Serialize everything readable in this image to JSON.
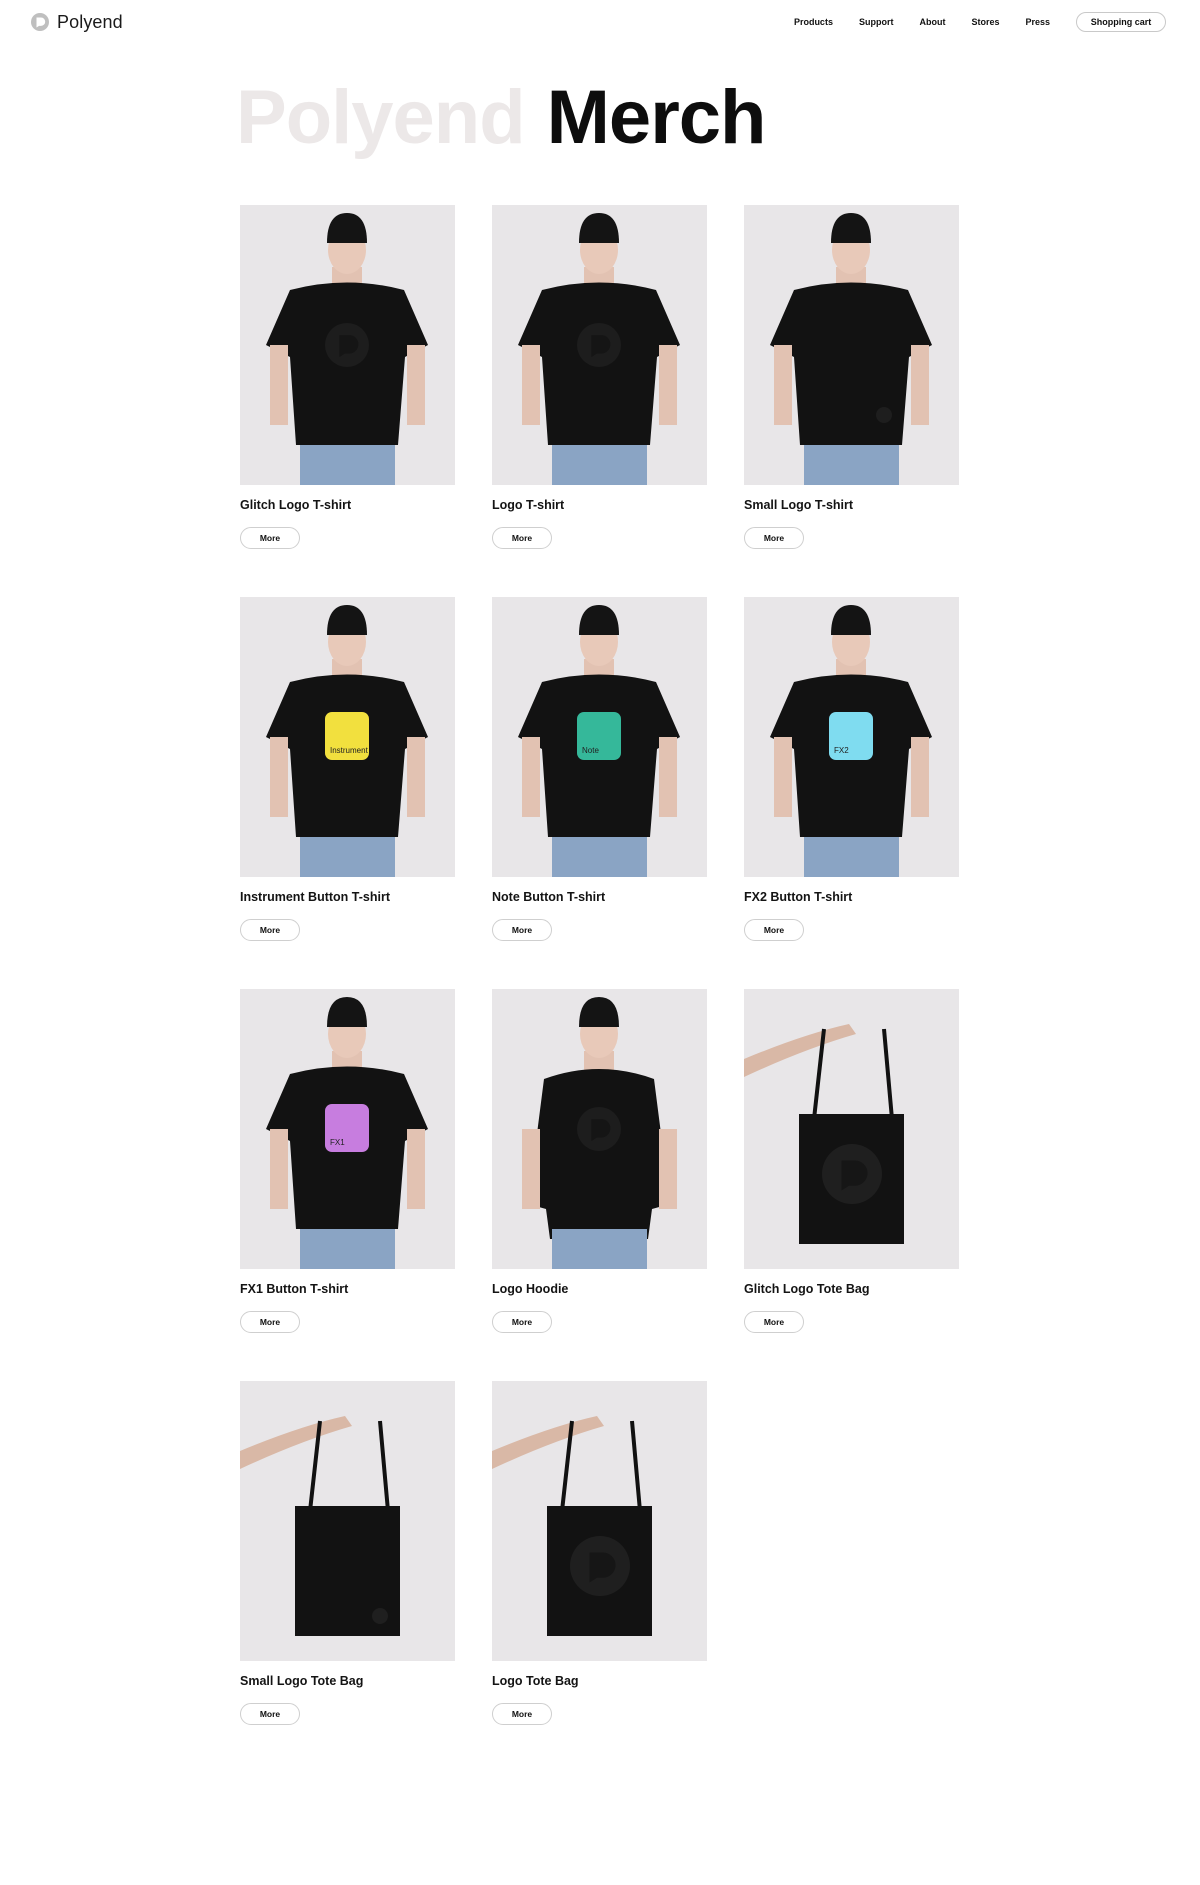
{
  "brand": {
    "name": "Polyend"
  },
  "nav": {
    "items": [
      "Products",
      "Support",
      "About",
      "Stores",
      "Press"
    ],
    "cart_label": "Shopping cart"
  },
  "hero": {
    "light": "Polyend",
    "dark": "Merch"
  },
  "products": [
    {
      "name": "Glitch Logo T-shirt",
      "more": "More",
      "kind": "shirt",
      "print": "big-logo"
    },
    {
      "name": "Logo T-shirt",
      "more": "More",
      "kind": "shirt",
      "print": "big-logo"
    },
    {
      "name": "Small Logo T-shirt",
      "more": "More",
      "kind": "shirt",
      "print": "small-logo"
    },
    {
      "name": "Instrument Button T-shirt",
      "more": "More",
      "kind": "shirt",
      "print": "button",
      "button_color": "#f2e03e",
      "button_label": "Instrument"
    },
    {
      "name": "Note Button T-shirt",
      "more": "More",
      "kind": "shirt",
      "print": "button",
      "button_color": "#35b89a",
      "button_label": "Note"
    },
    {
      "name": "FX2 Button T-shirt",
      "more": "More",
      "kind": "shirt",
      "print": "button",
      "button_color": "#7fdcf0",
      "button_label": "FX2"
    },
    {
      "name": "FX1 Button T-shirt",
      "more": "More",
      "kind": "shirt",
      "print": "button",
      "button_color": "#c77ddf",
      "button_label": "FX1"
    },
    {
      "name": "Logo Hoodie",
      "more": "More",
      "kind": "hoodie",
      "print": "big-logo"
    },
    {
      "name": "Glitch Logo Tote Bag",
      "more": "More",
      "kind": "tote",
      "print": "big-logo"
    },
    {
      "name": "Small Logo Tote Bag",
      "more": "More",
      "kind": "tote",
      "print": "small-logo"
    },
    {
      "name": "Logo Tote Bag",
      "more": "More",
      "kind": "tote",
      "print": "big-logo"
    }
  ],
  "colors": {
    "background": "#ffffff",
    "photo_bg": "#e8e6e8",
    "hero_light": "#ece8e8",
    "hero_dark": "#0d0d0d"
  }
}
